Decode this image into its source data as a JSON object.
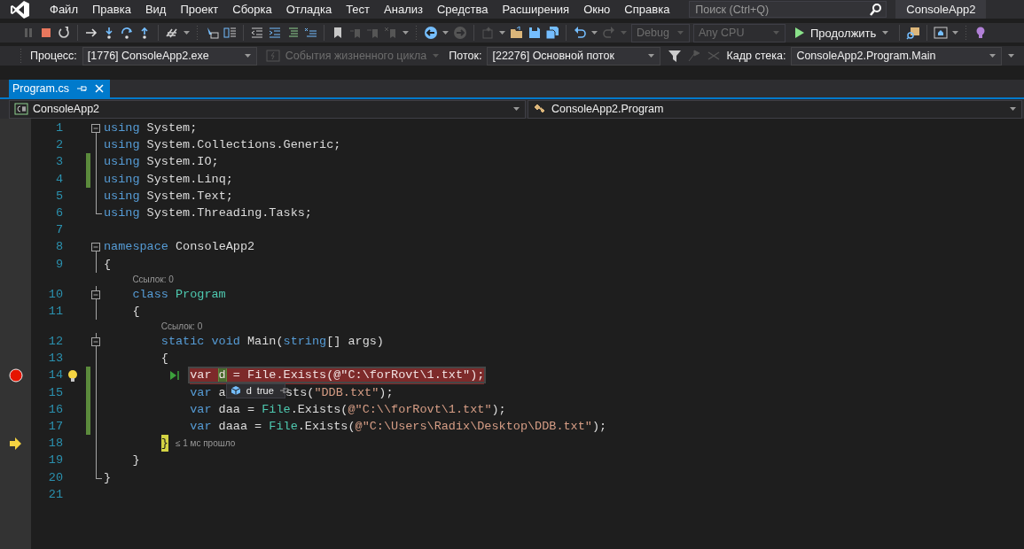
{
  "menu_bar": {
    "items": [
      "Файл",
      "Правка",
      "Вид",
      "Проект",
      "Сборка",
      "Отладка",
      "Тест",
      "Анализ",
      "Средства",
      "Расширения",
      "Окно",
      "Справка"
    ],
    "search": {
      "placeholder": "Поиск (Ctrl+Q)"
    },
    "solution_name": "ConsoleApp2"
  },
  "toolbar": {
    "configuration": {
      "value": "Debug",
      "disabled": true
    },
    "platform": {
      "value": "Any CPU",
      "disabled": true
    },
    "continue_button": {
      "label": "Продолжить"
    }
  },
  "debug_location": {
    "process_label": "Процесс:",
    "process": "[1776] ConsoleApp2.exe",
    "lifecycle_events": {
      "label": "События жизненного цикла",
      "disabled": true
    },
    "thread_label": "Поток:",
    "thread": "[22276] Основной поток",
    "stack_frame_label": "Кадр стека:",
    "stack_frame": "ConsoleApp2.Program.Main"
  },
  "tabs": [
    {
      "label": "Program.cs",
      "selected": true
    }
  ],
  "navigation_bar": {
    "project": "ConsoleApp2",
    "type": "ConsoleApp2.Program"
  },
  "editor": {
    "lines": [
      {
        "number": "1",
        "collapsible": true,
        "fold_end": false,
        "changed": false,
        "breakpoint": false,
        "current": false,
        "hovered": false,
        "tokens": [
          {
            "kind": "kw",
            "t": "using"
          },
          {
            "kind": "plain",
            "t": " System;"
          }
        ]
      },
      {
        "number": "2",
        "collapsible": false,
        "fold_end": false,
        "changed": false,
        "breakpoint": false,
        "current": false,
        "hovered": false,
        "tokens": [
          {
            "kind": "kw",
            "t": "using"
          },
          {
            "kind": "plain",
            "t": " System.Collections.Generic;"
          }
        ]
      },
      {
        "number": "3",
        "collapsible": false,
        "fold_end": false,
        "changed": true,
        "breakpoint": false,
        "current": false,
        "hovered": false,
        "tokens": [
          {
            "kind": "kw",
            "t": "using"
          },
          {
            "kind": "plain",
            "t": " System.IO;"
          }
        ]
      },
      {
        "number": "4",
        "collapsible": false,
        "fold_end": false,
        "changed": true,
        "breakpoint": false,
        "current": false,
        "hovered": false,
        "tokens": [
          {
            "kind": "kw",
            "t": "using"
          },
          {
            "kind": "plain",
            "t": " System.Linq;"
          }
        ]
      },
      {
        "number": "5",
        "collapsible": false,
        "fold_end": false,
        "changed": false,
        "breakpoint": false,
        "current": false,
        "hovered": false,
        "tokens": [
          {
            "kind": "kw",
            "t": "using"
          },
          {
            "kind": "plain",
            "t": " System.Text;"
          }
        ]
      },
      {
        "number": "6",
        "collapsible": false,
        "fold_end": true,
        "changed": false,
        "breakpoint": false,
        "current": false,
        "hovered": false,
        "tokens": [
          {
            "kind": "kw",
            "t": "using"
          },
          {
            "kind": "plain",
            "t": " System.Threading.Tasks;"
          }
        ]
      },
      {
        "number": "7",
        "collapsible": false,
        "fold_end": false,
        "changed": false,
        "breakpoint": false,
        "current": false,
        "hovered": false
      },
      {
        "number": "8",
        "collapsible": true,
        "fold_end": false,
        "changed": false,
        "breakpoint": false,
        "current": false,
        "hovered": false,
        "tokens": [
          {
            "kind": "kw",
            "t": "namespace"
          },
          {
            "kind": "plain",
            "t": " ConsoleApp2"
          }
        ]
      },
      {
        "number": "9",
        "collapsible": false,
        "fold_end": false,
        "changed": false,
        "breakpoint": false,
        "current": false,
        "hovered": false,
        "tokens": [
          {
            "kind": "plain",
            "t": "{"
          }
        ],
        "children": [
          {
            "number": "10",
            "collapsible": true,
            "fold_end": false,
            "changed": false,
            "breakpoint": false,
            "current": false,
            "hovered": false,
            "codelens": "Ссылок: 0",
            "tokens": [
              {
                "kind": "kw",
                "t": "class"
              },
              {
                "kind": "type",
                "t": " Program"
              }
            ]
          },
          {
            "number": "11",
            "collapsible": false,
            "fold_end": false,
            "changed": false,
            "breakpoint": false,
            "current": false,
            "hovered": false,
            "tokens": [
              {
                "kind": "plain",
                "t": "{"
              }
            ],
            "children": [
              {
                "number": "12",
                "collapsible": true,
                "fold_end": false,
                "changed": false,
                "breakpoint": false,
                "current": false,
                "hovered": false,
                "codelens": "Ссылок: 0",
                "tokens": [
                  {
                    "kind": "kw",
                    "t": "static void"
                  },
                  {
                    "kind": "plain",
                    "t": " Main("
                  },
                  {
                    "kind": "kw",
                    "t": "string"
                  },
                  {
                    "kind": "plain",
                    "t": "[] args)"
                  }
                ]
              },
              {
                "number": "13",
                "collapsible": false,
                "fold_end": false,
                "changed": false,
                "breakpoint": false,
                "current": false,
                "hovered": false,
                "tokens": [
                  {
                    "kind": "plain",
                    "t": "{"
                  }
                ],
                "children": [
                  {
                    "number": "14",
                    "collapsible": false,
                    "fold_end": false,
                    "changed": true,
                    "breakpoint": true,
                    "current": false,
                    "hovered": true,
                    "tokens": [
                      {
                        "kind": "kw",
                        "t": "var "
                      },
                      {
                        "kind": "ref",
                        "t": "d"
                      },
                      {
                        "kind": "plain",
                        "t": " = "
                      },
                      {
                        "kind": "type",
                        "t": "File"
                      },
                      {
                        "kind": "plain",
                        "t": ".Exists("
                      },
                      {
                        "kind": "str",
                        "t": "@\"C:\\forRovt\\1.txt\""
                      },
                      {
                        "kind": "plain",
                        "t": ");"
                      }
                    ]
                  },
                  {
                    "number": "15",
                    "collapsible": false,
                    "fold_end": false,
                    "changed": true,
                    "breakpoint": false,
                    "current": false,
                    "hovered": false,
                    "tokens": [
                      {
                        "kind": "kw",
                        "t": "var"
                      },
                      {
                        "kind": "plain",
                        "t": " a"
                      },
                      {
                        "kind": "datatip",
                        "name": "d",
                        "value": "true"
                      },
                      {
                        "kind": "plain",
                        "t": "sts("
                      },
                      {
                        "kind": "str",
                        "t": "\"DDB.txt\""
                      },
                      {
                        "kind": "plain",
                        "t": ");"
                      }
                    ]
                  },
                  {
                    "number": "16",
                    "collapsible": false,
                    "fold_end": false,
                    "changed": true,
                    "breakpoint": false,
                    "current": false,
                    "hovered": false,
                    "tokens": [
                      {
                        "kind": "kw",
                        "t": "var"
                      },
                      {
                        "kind": "plain",
                        "t": " daa = "
                      },
                      {
                        "kind": "type",
                        "t": "File"
                      },
                      {
                        "kind": "plain",
                        "t": ".Exists("
                      },
                      {
                        "kind": "str",
                        "t": "@\"C:\\\\forRovt\\1.txt\""
                      },
                      {
                        "kind": "plain",
                        "t": ");"
                      }
                    ]
                  },
                  {
                    "number": "17",
                    "collapsible": false,
                    "fold_end": false,
                    "changed": true,
                    "breakpoint": false,
                    "current": false,
                    "hovered": false,
                    "tokens": [
                      {
                        "kind": "kw",
                        "t": "var"
                      },
                      {
                        "kind": "plain",
                        "t": " daaa = "
                      },
                      {
                        "kind": "type",
                        "t": "File"
                      },
                      {
                        "kind": "plain",
                        "t": ".Exists("
                      },
                      {
                        "kind": "str",
                        "t": "@\"C:\\Users\\Radix\\Desktop\\DDB.txt\""
                      },
                      {
                        "kind": "plain",
                        "t": ");"
                      }
                    ]
                  }
                ]
              },
              {
                "number": "18",
                "collapsible": false,
                "fold_end": false,
                "changed": false,
                "breakpoint": false,
                "current": true,
                "hovered": false,
                "perf_tip": "≤ 1 мс прошло",
                "tokens": [
                  {
                    "kind": "plain",
                    "t": "}"
                  }
                ]
              }
            ]
          },
          {
            "number": "19",
            "collapsible": false,
            "fold_end": false,
            "changed": false,
            "breakpoint": false,
            "current": false,
            "hovered": false,
            "tokens": [
              {
                "kind": "plain",
                "t": "}"
              }
            ]
          }
        ]
      },
      {
        "number": "20",
        "collapsible": false,
        "fold_end": true,
        "changed": false,
        "breakpoint": false,
        "current": false,
        "hovered": false,
        "tokens": [
          {
            "kind": "plain",
            "t": "}"
          }
        ]
      },
      {
        "number": "21",
        "collapsible": false,
        "fold_end": false,
        "changed": false,
        "breakpoint": false,
        "current": false,
        "hovered": false
      }
    ]
  }
}
